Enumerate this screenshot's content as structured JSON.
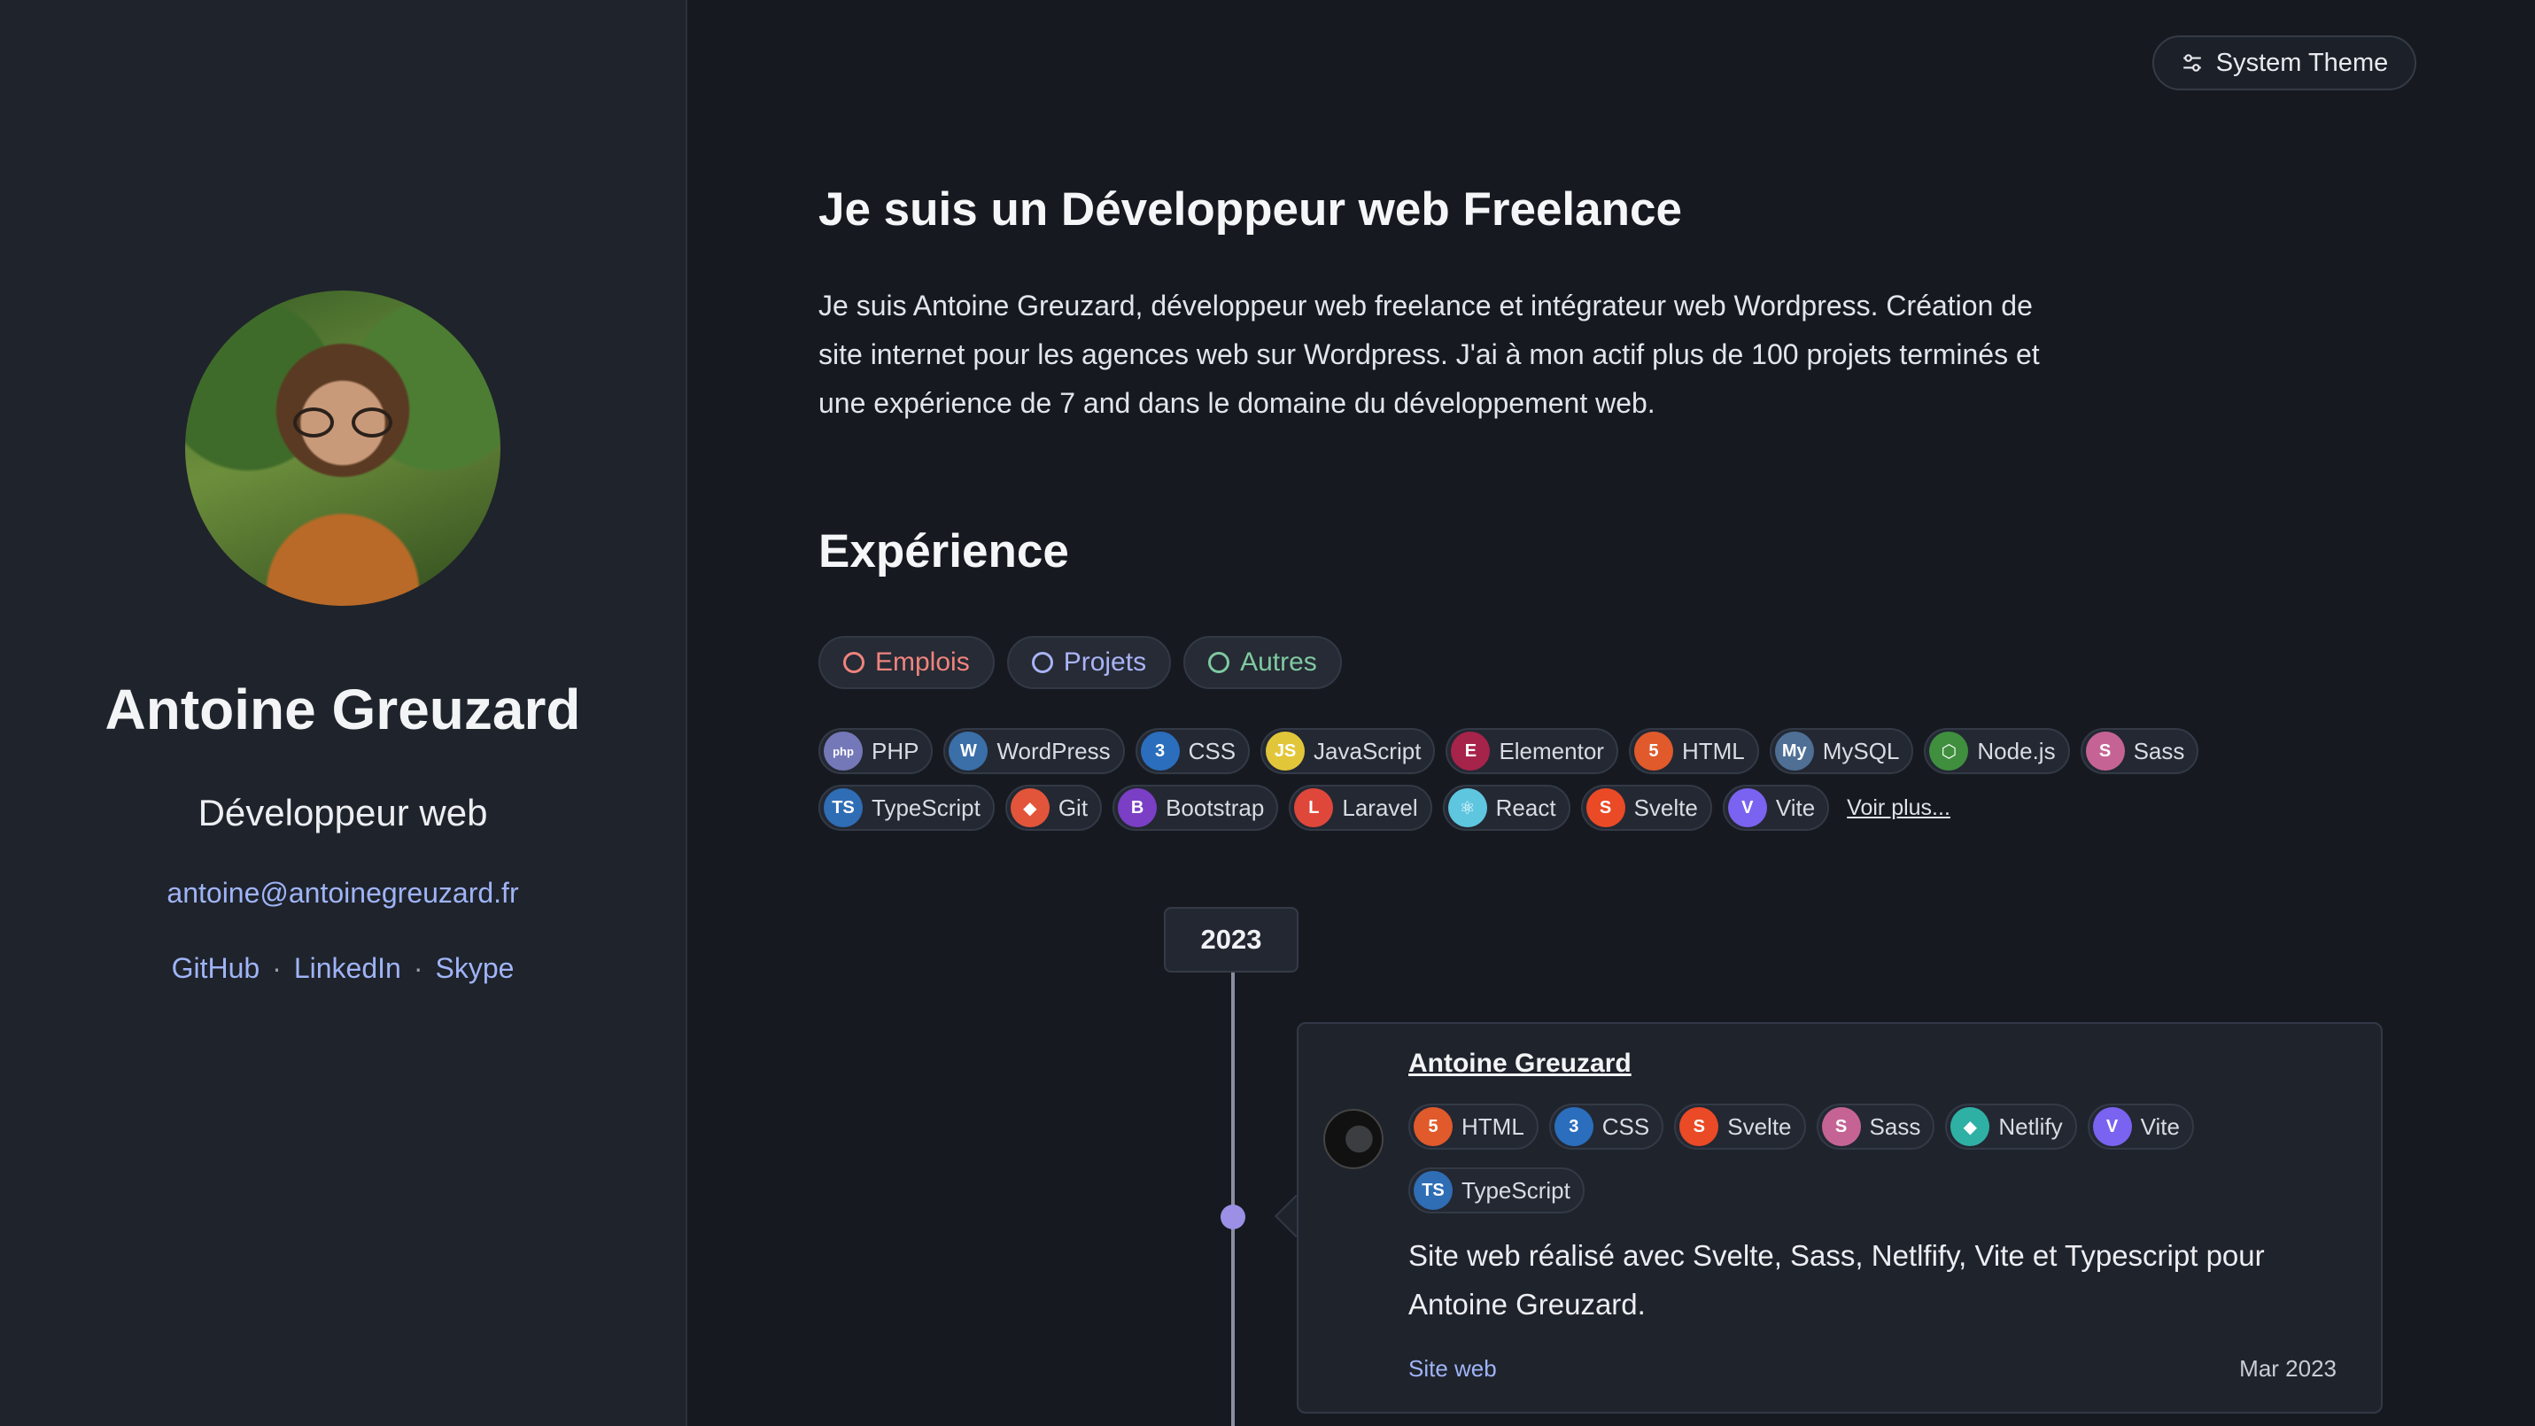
{
  "theme_button": {
    "label": "System Theme",
    "icon": "sliders-icon"
  },
  "profile": {
    "name": "Antoine Greuzard",
    "role": "Développeur web",
    "email": "antoine@antoinegreuzard.fr",
    "links": [
      "GitHub",
      "LinkedIn",
      "Skype"
    ],
    "separator": "·"
  },
  "intro": {
    "heading": "Je suis un Développeur web Freelance",
    "text": "Je suis Antoine Greuzard, développeur web freelance et intégrateur web Wordpress. Création de site internet pour les agences web sur Wordpress. J'ai à mon actif plus de 100 projets terminés et une expérience de 7 and dans le domaine du développement web."
  },
  "experience": {
    "heading": "Expérience",
    "filters": [
      {
        "label": "Emplois",
        "color": "#f0837d"
      },
      {
        "label": "Projets",
        "color": "#a9b3f7"
      },
      {
        "label": "Autres",
        "color": "#7fc9a1"
      }
    ],
    "tags": [
      {
        "label": "PHP",
        "icon": "php-icon",
        "glyph": "php",
        "color": "#7478b8"
      },
      {
        "label": "WordPress",
        "icon": "wordpress-icon",
        "glyph": "W",
        "color": "#3a6fa8"
      },
      {
        "label": "CSS",
        "icon": "css-icon",
        "glyph": "3",
        "color": "#2a6ebd"
      },
      {
        "label": "JavaScript",
        "icon": "javascript-icon",
        "glyph": "JS",
        "color": "#e2c63a"
      },
      {
        "label": "Elementor",
        "icon": "elementor-icon",
        "glyph": "E",
        "color": "#a6234a"
      },
      {
        "label": "HTML",
        "icon": "html-icon",
        "glyph": "5",
        "color": "#e05a2b"
      },
      {
        "label": "MySQL",
        "icon": "mysql-icon",
        "glyph": "My",
        "color": "#4f6f95"
      },
      {
        "label": "Node.js",
        "icon": "nodejs-icon",
        "glyph": "⬡",
        "color": "#3f8f3f"
      },
      {
        "label": "Sass",
        "icon": "sass-icon",
        "glyph": "S",
        "color": "#c56494"
      },
      {
        "label": "TypeScript",
        "icon": "typescript-icon",
        "glyph": "TS",
        "color": "#2f6db5"
      },
      {
        "label": "Git",
        "icon": "git-icon",
        "glyph": "◆",
        "color": "#e2553a"
      },
      {
        "label": "Bootstrap",
        "icon": "bootstrap-icon",
        "glyph": "B",
        "color": "#7a3fc4"
      },
      {
        "label": "Laravel",
        "icon": "laravel-icon",
        "glyph": "L",
        "color": "#e0473b"
      },
      {
        "label": "React",
        "icon": "react-icon",
        "glyph": "⚛",
        "color": "#5fc6e0"
      },
      {
        "label": "Svelte",
        "icon": "svelte-icon",
        "glyph": "S",
        "color": "#ea4a26"
      },
      {
        "label": "Vite",
        "icon": "vite-icon",
        "glyph": "V",
        "color": "#7a63f0"
      }
    ],
    "more_label": "Voir plus..."
  },
  "timeline": {
    "year": "2023",
    "card": {
      "title": "Antoine Greuzard",
      "tags": [
        {
          "label": "HTML",
          "icon": "html-icon",
          "glyph": "5",
          "color": "#e05a2b"
        },
        {
          "label": "CSS",
          "icon": "css-icon",
          "glyph": "3",
          "color": "#2a6ebd"
        },
        {
          "label": "Svelte",
          "icon": "svelte-icon",
          "glyph": "S",
          "color": "#ea4a26"
        },
        {
          "label": "Sass",
          "icon": "sass-icon",
          "glyph": "S",
          "color": "#c56494"
        },
        {
          "label": "Netlify",
          "icon": "netlify-icon",
          "glyph": "◆",
          "color": "#2fb0a4"
        },
        {
          "label": "Vite",
          "icon": "vite-icon",
          "glyph": "V",
          "color": "#7a63f0"
        },
        {
          "label": "TypeScript",
          "icon": "typescript-icon",
          "glyph": "TS",
          "color": "#2f6db5"
        }
      ],
      "description": "Site web réalisé avec Svelte, Sass, Netlfify, Vite et Typescript pour Antoine Greuzard.",
      "link_label": "Site web",
      "date": "Mar 2023"
    }
  }
}
